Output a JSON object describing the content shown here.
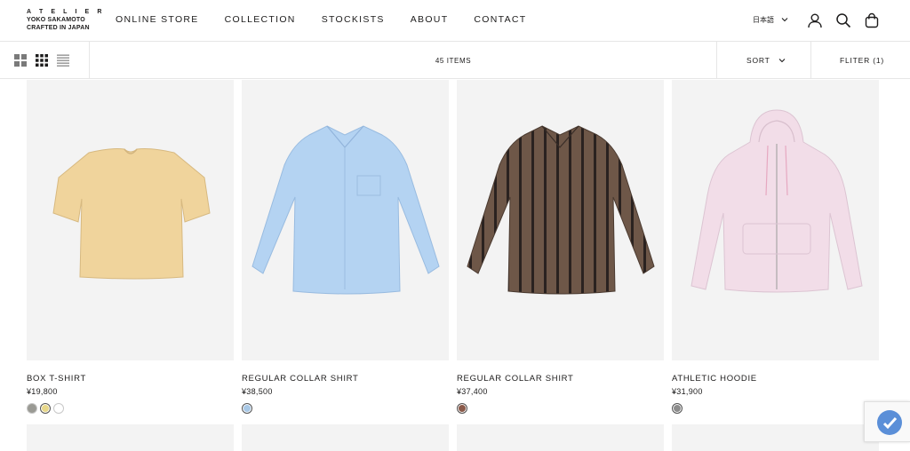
{
  "brand": {
    "line1": "A T E L I E R",
    "line2": "YOKO SAKAMOTO",
    "line3": "CRAFTED IN JAPAN"
  },
  "nav": [
    {
      "label": "ONLINE STORE"
    },
    {
      "label": "COLLECTION"
    },
    {
      "label": "STOCKISTS"
    },
    {
      "label": "ABOUT"
    },
    {
      "label": "CONTACT"
    }
  ],
  "header": {
    "language": "日本語",
    "icons": [
      "account-icon",
      "search-icon",
      "cart-icon"
    ]
  },
  "toolbar": {
    "layout_icons": [
      "grid-2-icon",
      "grid-3-icon",
      "list-icon"
    ],
    "items_count": "45 ITEMS",
    "sort_label": "SORT",
    "filter_label": "FLITER (1)"
  },
  "products": [
    {
      "name": "BOX T-SHIRT",
      "price": "¥19,800",
      "swatches": [
        "#9a9a94",
        "#e8d88a",
        "#ffffff"
      ],
      "garment_color": "#f0d49c"
    },
    {
      "name": "REGULAR COLLAR SHIRT",
      "price": "¥38,500",
      "swatches": [
        "#a8c8e6"
      ],
      "garment_color": "#b4d3f2"
    },
    {
      "name": "REGULAR COLLAR SHIRT",
      "price": "¥37,400",
      "swatches": [
        "#8a5a4a"
      ],
      "garment_color": "#6e5748"
    },
    {
      "name": "ATHLETIC HOODIE",
      "price": "¥31,900",
      "swatches": [
        "#8c8c8c"
      ],
      "garment_color": "#f2dde8"
    }
  ]
}
